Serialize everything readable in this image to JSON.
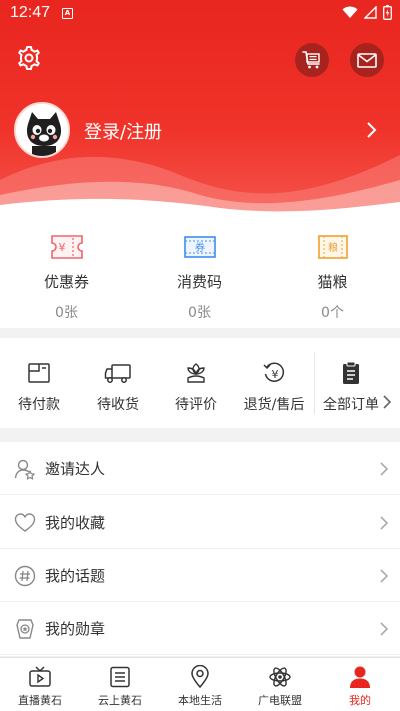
{
  "status_bar": {
    "time": "12:47",
    "a_badge": "A"
  },
  "profile": {
    "login_text": "登录/注册"
  },
  "coupons": [
    {
      "label": "优惠券",
      "count": "0张",
      "icon": "coupon-ticket-icon",
      "badge": "¥",
      "color": "#f0646e"
    },
    {
      "label": "消费码",
      "count": "0张",
      "icon": "voucher-code-icon",
      "badge": "券",
      "color": "#3d8ef0"
    },
    {
      "label": "猫粮",
      "count": "0个",
      "icon": "cat-food-icon",
      "badge": "粮",
      "color": "#f0a030"
    }
  ],
  "orders": [
    {
      "label": "待付款",
      "icon": "wallet-icon"
    },
    {
      "label": "待收货",
      "icon": "truck-icon"
    },
    {
      "label": "待评价",
      "icon": "flower-review-icon"
    },
    {
      "label": "退货/售后",
      "icon": "refund-icon"
    },
    {
      "label": "全部订单",
      "icon": "clipboard-icon"
    }
  ],
  "menu": [
    {
      "label": "邀请达人",
      "icon": "invite-user-icon"
    },
    {
      "label": "我的收藏",
      "icon": "heart-icon"
    },
    {
      "label": "我的话题",
      "icon": "hashtag-icon"
    },
    {
      "label": "我的勋章",
      "icon": "medal-icon"
    }
  ],
  "bottom_nav": [
    {
      "label": "直播黄石",
      "icon": "tv-icon",
      "active": false
    },
    {
      "label": "云上黄石",
      "icon": "list-icon",
      "active": false
    },
    {
      "label": "本地生活",
      "icon": "location-pin-icon",
      "active": false
    },
    {
      "label": "广电联盟",
      "icon": "atom-icon",
      "active": false
    },
    {
      "label": "我的",
      "icon": "person-icon",
      "active": true
    }
  ],
  "colors": {
    "brand_red": "#e8261f",
    "dark_red_button": "#a8231d"
  }
}
